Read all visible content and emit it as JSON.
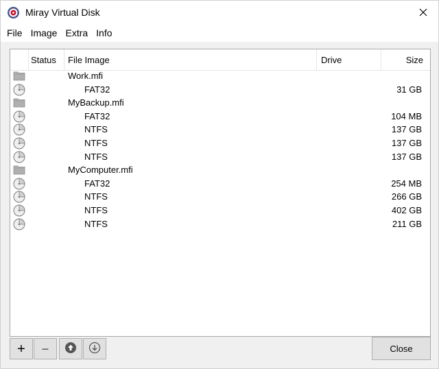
{
  "window": {
    "title": "Miray Virtual Disk"
  },
  "menu": [
    "File",
    "Image",
    "Extra",
    "Info"
  ],
  "columns": {
    "status": "Status",
    "file_image": "File Image",
    "drive": "Drive",
    "size": "Size"
  },
  "rows": [
    {
      "kind": "image",
      "icon": "folder-icon",
      "name": "Work.mfi",
      "size": ""
    },
    {
      "kind": "partition",
      "icon": "disk-icon",
      "name": "FAT32",
      "size": "31 GB"
    },
    {
      "kind": "image",
      "icon": "folder-icon",
      "name": "MyBackup.mfi",
      "size": ""
    },
    {
      "kind": "partition",
      "icon": "disk-icon",
      "name": "FAT32",
      "size": "104 MB"
    },
    {
      "kind": "partition",
      "icon": "disk-icon",
      "name": "NTFS",
      "size": "137 GB"
    },
    {
      "kind": "partition",
      "icon": "disk-icon",
      "name": "NTFS",
      "size": "137 GB"
    },
    {
      "kind": "partition",
      "icon": "disk-icon",
      "name": "NTFS",
      "size": "137 GB"
    },
    {
      "kind": "image",
      "icon": "folder-icon",
      "name": "MyComputer.mfi",
      "size": ""
    },
    {
      "kind": "partition",
      "icon": "disk-icon",
      "name": "FAT32",
      "size": "254 MB"
    },
    {
      "kind": "partition",
      "icon": "disk-icon",
      "name": "NTFS",
      "size": "266 GB"
    },
    {
      "kind": "partition",
      "icon": "disk-icon",
      "name": "NTFS",
      "size": "402 GB"
    },
    {
      "kind": "partition",
      "icon": "disk-icon",
      "name": "NTFS",
      "size": "211 GB"
    }
  ],
  "toolbar": {
    "add": "+",
    "remove": "−",
    "close_label": "Close"
  },
  "icons": [
    "app-logo-icon",
    "close-icon",
    "folder-icon",
    "disk-icon",
    "mount-up-icon",
    "unmount-down-icon"
  ]
}
